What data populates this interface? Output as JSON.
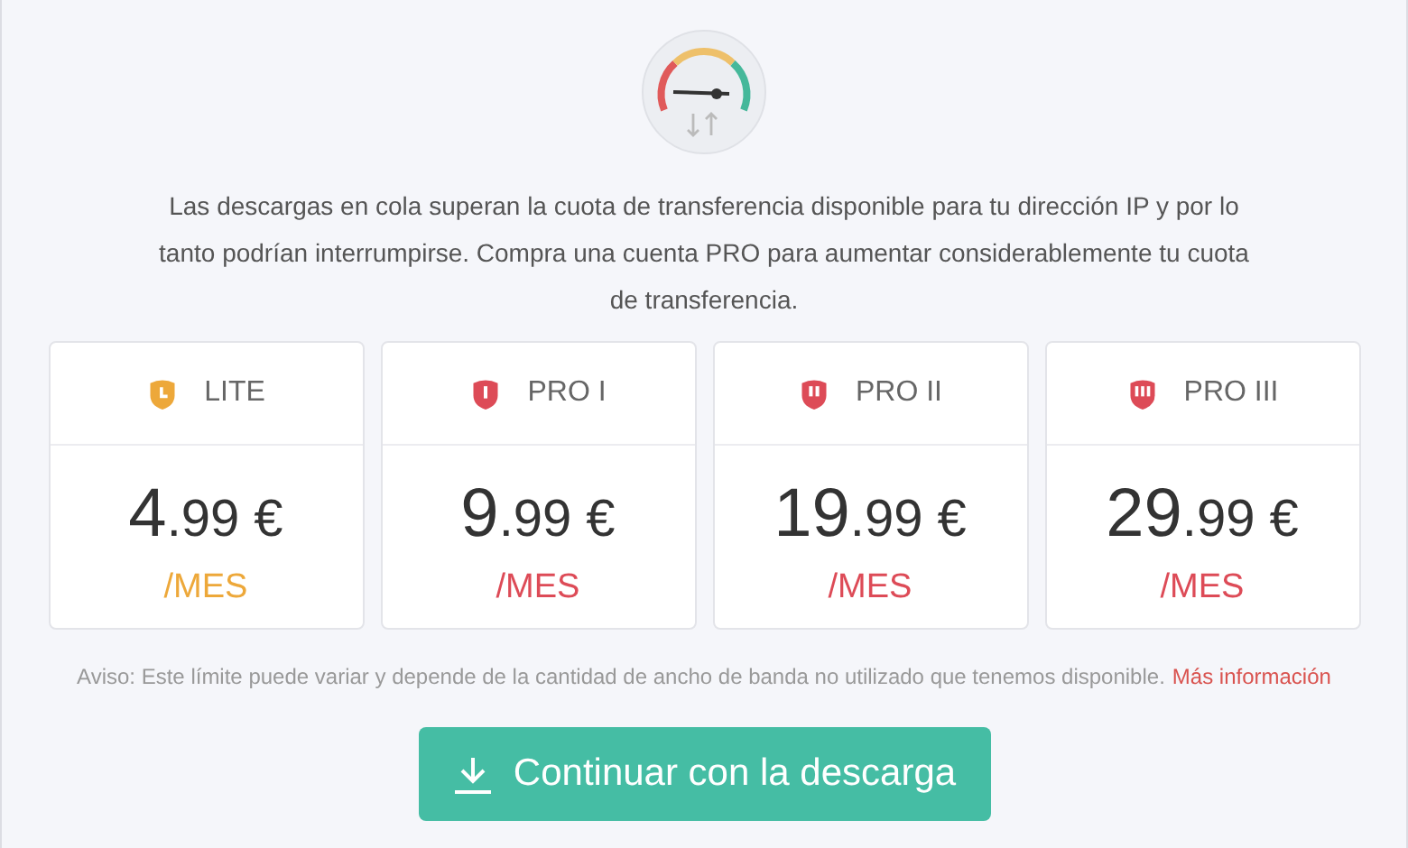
{
  "message": "Las descargas en cola superan la cuota de transferencia disponible para tu dirección IP y por lo tanto podrían interrumpirse. Compra una cuenta PRO para aumentar considerablemente tu cuota de transferencia.",
  "plans": [
    {
      "kind": "clock",
      "name": "LITE",
      "price_whole": "4",
      "price_rest": ".99 €",
      "period": "/MES",
      "color": "#eda83a"
    },
    {
      "kind": "alert",
      "name": "PRO I",
      "price_whole": "9",
      "price_rest": ".99 €",
      "period": "/MES",
      "color": "#dd4b57"
    },
    {
      "kind": "two",
      "name": "PRO II",
      "price_whole": "19",
      "price_rest": ".99 €",
      "period": "/MES",
      "color": "#dd4b57"
    },
    {
      "kind": "three",
      "name": "PRO III",
      "price_whole": "29",
      "price_rest": ".99 €",
      "period": "/MES",
      "color": "#dd4b57"
    }
  ],
  "notice": {
    "text": "Aviso: Este límite puede variar y depende de la cantidad de ancho de banda no utilizado que tenemos disponible.",
    "link": "Más información"
  },
  "button": "Continuar con la descarga"
}
